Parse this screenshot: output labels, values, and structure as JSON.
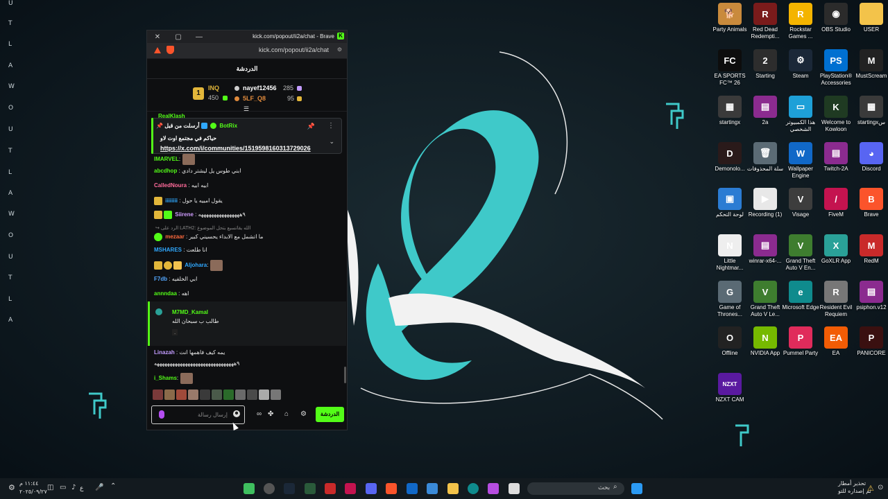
{
  "desktop": {
    "side_letters": [
      "U",
      "T",
      "L",
      "A",
      "W",
      "O",
      "U",
      "T",
      "L",
      "A",
      "W",
      "O",
      "U",
      "T",
      "L",
      "A"
    ],
    "icons": [
      {
        "label": "Party Animals",
        "icon": "dog-icon",
        "color": "#c98a3c",
        "glyph": "🐕"
      },
      {
        "label": "Red Dead Redempti...",
        "icon": "rdr-icon",
        "color": "#7a1b1b",
        "glyph": "R"
      },
      {
        "label": "Rockstar Games ...",
        "icon": "rockstar-icon",
        "color": "#f4b400",
        "glyph": "R"
      },
      {
        "label": "OBS Studio",
        "icon": "obs-icon",
        "color": "#2b2b2b",
        "glyph": "◉"
      },
      {
        "label": "USER",
        "icon": "folder-icon",
        "color": "#f3c34a",
        "glyph": ""
      },
      {
        "label": "EA SPORTS FC™ 26",
        "icon": "ea-fc-icon",
        "color": "#0d0d0d",
        "glyph": "FC"
      },
      {
        "label": "Starting",
        "icon": "starting-icon",
        "color": "#2d2d2d",
        "glyph": "2"
      },
      {
        "label": "Steam",
        "icon": "steam-icon",
        "color": "#1b2838",
        "glyph": "⚙"
      },
      {
        "label": "PlayStation® Accessories",
        "icon": "playstation-icon",
        "color": "#0070d1",
        "glyph": "PS"
      },
      {
        "label": "MustScream",
        "icon": "mustscream-icon",
        "color": "#222",
        "glyph": "M"
      },
      {
        "label": "startingx",
        "icon": "startingx-icon",
        "color": "#3a3a3a",
        "glyph": "▦"
      },
      {
        "label": "2a",
        "icon": "winrar-icon",
        "color": "#8b2b8f",
        "glyph": "▤"
      },
      {
        "label": "هذا الكمبيوتر الشخصي",
        "icon": "this-pc-icon",
        "color": "#1ea0d8",
        "glyph": "▭"
      },
      {
        "label": "Welcome to Kowloon",
        "icon": "kowloon-icon",
        "color": "#1f3a22",
        "glyph": "K"
      },
      {
        "label": "startingxس",
        "icon": "startingx-icon",
        "color": "#3a3a3a",
        "glyph": "▦"
      },
      {
        "label": "Demonolo...",
        "icon": "demonologist-icon",
        "color": "#2a1a1a",
        "glyph": "D"
      },
      {
        "label": "سلة المحذوفات",
        "icon": "recycle-bin-icon",
        "color": "#5b6b75",
        "glyph": "🗑"
      },
      {
        "label": "Wallpaper Engine",
        "icon": "wallpaper-engine-icon",
        "color": "#1168c7",
        "glyph": "W"
      },
      {
        "label": "Twitch-2A",
        "icon": "winrar-icon",
        "color": "#8b2b8f",
        "glyph": "▤"
      },
      {
        "label": "Discord",
        "icon": "discord-icon",
        "color": "#5865f2",
        "glyph": "◕"
      },
      {
        "label": "لوحة التحكم",
        "icon": "control-panel-icon",
        "color": "#2b7cd3",
        "glyph": "▣"
      },
      {
        "label": "Recording (1)",
        "icon": "video-icon",
        "color": "#e8e8e8",
        "glyph": "▶"
      },
      {
        "label": "Visage",
        "icon": "visage-icon",
        "color": "#3d3d3d",
        "glyph": "V"
      },
      {
        "label": "FiveM",
        "icon": "fivem-icon",
        "color": "#c4134f",
        "glyph": "/"
      },
      {
        "label": "Brave",
        "icon": "brave-icon",
        "color": "#fb542b",
        "glyph": "B"
      },
      {
        "label": "Little Nightmar...",
        "icon": "little-nightmares-icon",
        "color": "#eeeeee",
        "glyph": "N"
      },
      {
        "label": "winrar-x64-...",
        "icon": "winrar-icon",
        "color": "#8b2b8f",
        "glyph": "▤"
      },
      {
        "label": "Grand Theft Auto V En...",
        "icon": "gta-icon",
        "color": "#3e7d2f",
        "glyph": "V"
      },
      {
        "label": "GoXLR App",
        "icon": "goxlr-icon",
        "color": "#2aa198",
        "glyph": "X"
      },
      {
        "label": "RedM",
        "icon": "redm-icon",
        "color": "#c92a2a",
        "glyph": "M"
      },
      {
        "label": "Game of Thrones...",
        "icon": "got-icon",
        "color": "#5a6a74",
        "glyph": "G"
      },
      {
        "label": "Grand Theft Auto V Le...",
        "icon": "gta-icon",
        "color": "#3e7d2f",
        "glyph": "V"
      },
      {
        "label": "Microsoft Edge",
        "icon": "edge-icon",
        "color": "#0f8b8d",
        "glyph": "e"
      },
      {
        "label": "Resident Evil Requiem",
        "icon": "resident-evil-icon",
        "color": "#777",
        "glyph": "R"
      },
      {
        "label": "psiphon.v12",
        "icon": "winrar-icon",
        "color": "#8b2b8f",
        "glyph": "▤"
      },
      {
        "label": "Offline",
        "icon": "offline-icon",
        "color": "#222",
        "glyph": "O"
      },
      {
        "label": "NVIDIA App",
        "icon": "nvidia-icon",
        "color": "#76b900",
        "glyph": "N"
      },
      {
        "label": "Pummel Party",
        "icon": "pummel-party-icon",
        "color": "#e02b5b",
        "glyph": "P"
      },
      {
        "label": "EA",
        "icon": "ea-icon",
        "color": "#f25c05",
        "glyph": "EA"
      },
      {
        "label": "PANICORE",
        "icon": "panicore-icon",
        "color": "#3a1010",
        "glyph": "P"
      },
      {
        "label": "NZXT CAM",
        "icon": "nzxt-icon",
        "color": "#5a1aa0",
        "glyph": "NZXT"
      }
    ]
  },
  "browser": {
    "title": "kick.com/popout/ii2a/chat - Brave",
    "url": "kick.com/popout/ii2a/chat",
    "close": "✕",
    "maximize": "▢",
    "minimize": "—"
  },
  "chat": {
    "header": "الدردشة",
    "leaderboard": {
      "rank": "1",
      "first_name": "INQ",
      "first_value": "450",
      "second_name": "nayef12456",
      "second_value": "285",
      "third_name": "5LF_Q8",
      "third_value": "95"
    },
    "partial_user": "RealKlash",
    "pinned": {
      "header": "أرسلت من قبل",
      "bot": "BotRix",
      "message": "حياكم في مجتمع اوت لاو",
      "link": "https://x.com/i/communities/1519598160313729026"
    },
    "messages": [
      {
        "user": "IMARVEL",
        "text": ":",
        "color": "#53fc18"
      },
      {
        "user": "abcdhop",
        "text": ": ابني طوس يل ليشتر دادي",
        "color": "#53fc18"
      },
      {
        "user": "CalledNoura",
        "text": ": ابيه ابيه",
        "color": "#ff6b9a"
      },
      {
        "user": "iiiiiiii",
        "text": ": يقول امييه يا حول",
        "color": "#2fa8ff"
      },
      {
        "user": "Siirene",
        "text": ": ٩ههههههههههههههههه",
        "color": "#cf9cff"
      },
      {
        "user": "الرد على LATH2: الله يقاتسيع بتحل الموضوع",
        "text": "",
        "color": "#888888"
      },
      {
        "user": "mezaar",
        "text": ": ما اتشمل مع الابداء يحسيني كبير",
        "color": "#ff6a3d"
      },
      {
        "user": "MSHARES",
        "text": ": انا طلعت",
        "color": "#2fa8ff"
      },
      {
        "user": "Aljohara",
        "text": ":",
        "color": "#2fa8ff"
      },
      {
        "user": "F7db",
        "text": ": ابي الخلفيه",
        "color": "#53a7ff"
      },
      {
        "user": "annndaa",
        "text": ": اهه",
        "color": "#53fc18"
      }
    ],
    "highlight": {
      "user": "M7MD_Kamal",
      "line1": "طالب ب سبحان الله",
      "line2": "."
    },
    "after": [
      {
        "user": "Linazah",
        "text": ": يمه كيف فاهمها انت",
        "color": "#c39cff"
      },
      {
        "user": "",
        "text": "٩هههههههههههههههههههههههههههههههه",
        "color": "#ffffff"
      },
      {
        "user": "i_Shams",
        "text": ":",
        "color": "#53fc18"
      }
    ],
    "composer_placeholder": "إرسال رسالة",
    "send_label": "الدردشة"
  },
  "taskbar": {
    "search_placeholder": "بحث",
    "time": "١١:٤٤ م",
    "date": "٢٠٢٥/٠٩/٢٧",
    "lang": "ع",
    "update_line1": "تحذير أمطار",
    "update_line2": "تم إصداره للتو"
  }
}
